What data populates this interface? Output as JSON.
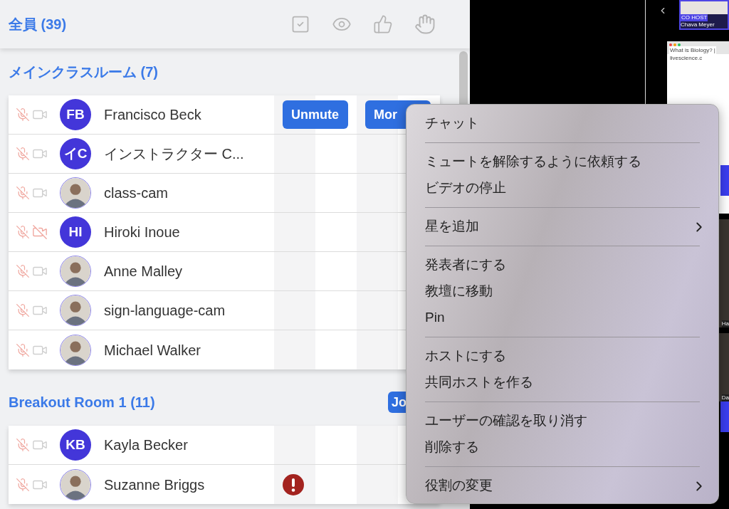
{
  "header": {
    "title": "全員 (39)"
  },
  "sections": [
    {
      "title": "メインクラスルーム (7)",
      "rows": [
        {
          "name": "Francisco Beck",
          "avatar": {
            "kind": "initials",
            "text": "FB"
          },
          "camera_on": true,
          "alert": false,
          "buttons": [
            "Unmute",
            "Mor"
          ]
        },
        {
          "name": "インストラクター C...",
          "avatar": {
            "kind": "initials",
            "text": "イC"
          },
          "camera_on": true,
          "alert": false,
          "buttons": []
        },
        {
          "name": "class-cam",
          "avatar": {
            "kind": "photo"
          },
          "camera_on": true,
          "alert": false,
          "buttons": []
        },
        {
          "name": "Hiroki Inoue",
          "avatar": {
            "kind": "initials",
            "text": "HI"
          },
          "camera_on": false,
          "alert": false,
          "buttons": []
        },
        {
          "name": "Anne Malley",
          "avatar": {
            "kind": "photo"
          },
          "camera_on": true,
          "alert": false,
          "buttons": []
        },
        {
          "name": "sign-language-cam",
          "avatar": {
            "kind": "photo"
          },
          "camera_on": true,
          "alert": false,
          "buttons": []
        },
        {
          "name": "Michael Walker",
          "avatar": {
            "kind": "photo"
          },
          "camera_on": true,
          "alert": false,
          "buttons": []
        }
      ]
    },
    {
      "title": "Breakout Room 1 (11)",
      "buttons": [
        "Jo"
      ],
      "rows": [
        {
          "name": "Kayla Becker",
          "avatar": {
            "kind": "initials",
            "text": "KB"
          },
          "camera_on": true,
          "alert": false,
          "buttons": []
        },
        {
          "name": "Suzanne Briggs",
          "avatar": {
            "kind": "photo"
          },
          "camera_on": true,
          "alert": true,
          "buttons": []
        }
      ]
    }
  ],
  "video": {
    "cohost_badge": "CO HOST",
    "cohost_name": "Chava Meyer",
    "browser_tab": "What is Biology? |",
    "browser_url": "livescience.c",
    "tile_names": [
      "Ha",
      "Da"
    ]
  },
  "menu": [
    [
      {
        "label": "チャット",
        "has_submenu": false
      }
    ],
    [
      {
        "label": "ミュートを解除するように依頼する",
        "has_submenu": false
      },
      {
        "label": "ビデオの停止",
        "has_submenu": false
      }
    ],
    [
      {
        "label": "星を追加",
        "has_submenu": true
      }
    ],
    [
      {
        "label": "発表者にする",
        "has_submenu": false
      },
      {
        "label": "教壇に移動",
        "has_submenu": false
      },
      {
        "label": "Pin",
        "has_submenu": false
      }
    ],
    [
      {
        "label": "ホストにする",
        "has_submenu": false
      },
      {
        "label": "共同ホストを作る",
        "has_submenu": false
      }
    ],
    [
      {
        "label": "ユーザーの確認を取り消す",
        "has_submenu": false
      },
      {
        "label": "削除する",
        "has_submenu": false
      }
    ],
    [
      {
        "label": "役割の変更",
        "has_submenu": true
      }
    ]
  ]
}
